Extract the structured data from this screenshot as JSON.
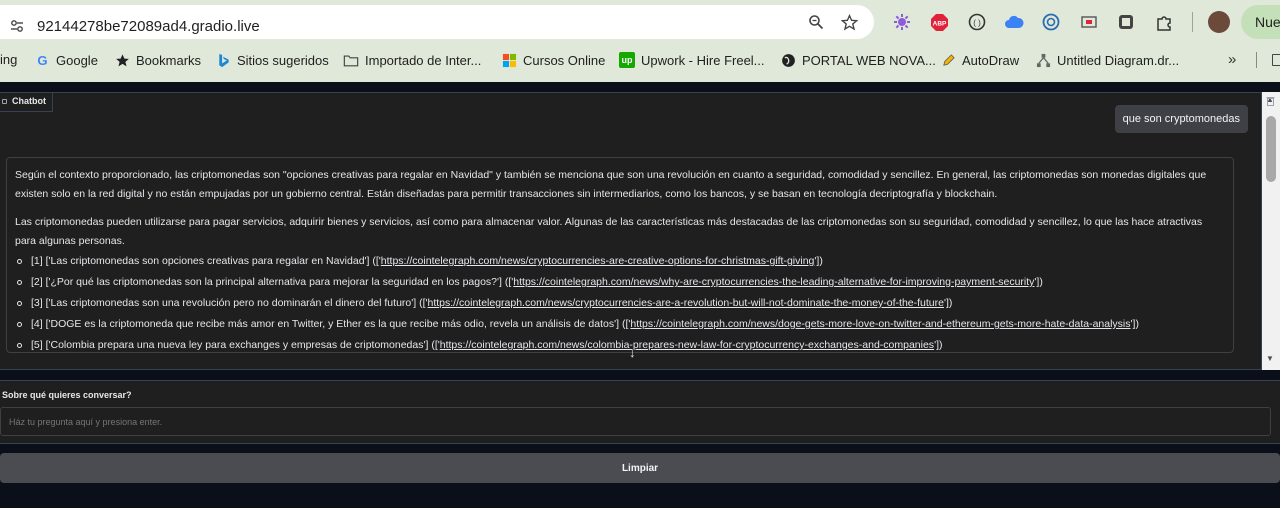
{
  "browser": {
    "url": "92144278be72089ad4.gradio.live",
    "new_tab_label": "Nuev"
  },
  "bookmarks": [
    {
      "label": "ing",
      "icon": "cropped-bookmark"
    },
    {
      "label": "Google",
      "icon": "google-icon"
    },
    {
      "label": "Bookmarks",
      "icon": "star-icon"
    },
    {
      "label": "Sitios sugeridos",
      "icon": "bing-icon"
    },
    {
      "label": "Importado de Inter...",
      "icon": "folder-icon"
    },
    {
      "label": "Cursos Online",
      "icon": "microsoft-icon"
    },
    {
      "label": "Upwork - Hire Freel...",
      "icon": "upwork-icon"
    },
    {
      "label": "PORTAL WEB NOVA...",
      "icon": "globe-icon"
    },
    {
      "label": "AutoDraw",
      "icon": "pencil-icon"
    },
    {
      "label": "Untitled Diagram.dr...",
      "icon": "drawio-icon"
    }
  ],
  "chatbot": {
    "label": "Chatbot",
    "user_message": "que son cryptomonedas",
    "bot_paragraph_1": "Según el contexto proporcionado, las criptomonedas son \"opciones creativas para regalar en Navidad\" y también se menciona que son una revolución en cuanto a seguridad, comodidad y sencillez. En general, las criptomonedas son monedas digitales que existen solo en la red digital y no están empujadas por un gobierno central. Están diseñadas para permitir transacciones sin intermediarios, como los bancos, y se basan en tecnología decriptografía y blockchain.",
    "bot_paragraph_2": "Las criptomonedas pueden utilizarse para pagar servicios, adquirir bienes y servicios, así como para almacenar valor. Algunas de las características más destacadas de las criptomonedas son su seguridad, comodidad y sencillez, lo que las hace atractivas para algunas personas.",
    "sources": [
      {
        "prefix": "[1] ['Las criptomonedas son opciones creativas para regalar en Navidad'] (['",
        "link": "https://cointelegraph.com/news/cryptocurrencies-are-creative-options-for-christmas-gift-giving",
        "suffix": "'])"
      },
      {
        "prefix": "[2] ['¿Por qué las criptomonedas son la principal alternativa para mejorar la seguridad en los pagos?'] (['",
        "link": "https://cointelegraph.com/news/why-are-cryptocurrencies-the-leading-alternative-for-improving-payment-security",
        "suffix": "'])"
      },
      {
        "prefix": "[3] ['Las criptomonedas son una revolución pero no dominarán el dinero del futuro'] (['",
        "link": "https://cointelegraph.com/news/cryptocurrencies-are-a-revolution-but-will-not-dominate-the-money-of-the-future",
        "suffix": "'])"
      },
      {
        "prefix": "[4] ['DOGE es la criptomoneda que recibe más amor en Twitter, y Ether es la que recibe más odio, revela un análisis de datos'] (['",
        "link": "https://cointelegraph.com/news/doge-gets-more-love-on-twitter-and-ethereum-gets-more-hate-data-analysis",
        "suffix": "'])"
      },
      {
        "prefix": "[5] ['Colombia prepara una nueva ley para exchanges y empresas de criptomonedas'] (['",
        "link": "https://cointelegraph.com/news/colombia-prepares-new-law-for-cryptocurrency-exchanges-and-companies",
        "suffix": "'])"
      }
    ]
  },
  "input": {
    "label": "Sobre qué quieres conversar?",
    "placeholder": "Ház tu pregunta aquí y presiona enter.",
    "value": ""
  },
  "clear_button": {
    "label": "Limpiar"
  },
  "colors": {
    "background": "#0b0f19",
    "panel": "#1f1f1f",
    "chrome": "#dfe8d9",
    "button": "#4b4b52"
  }
}
